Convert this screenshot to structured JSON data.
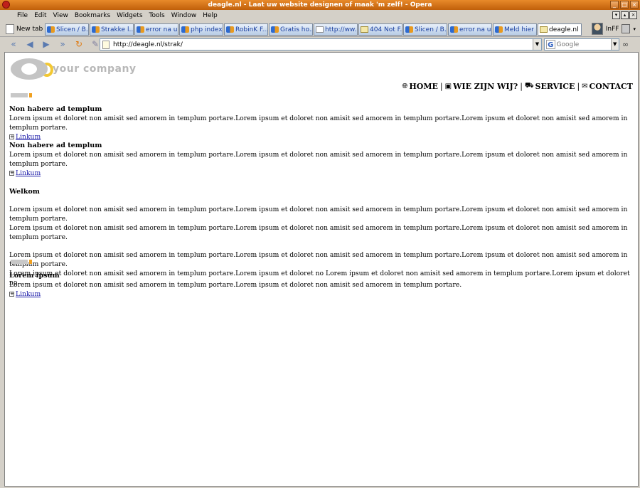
{
  "window": {
    "title": "deagle.nl - Laat uw website designen of maak 'm zelf! - Opera",
    "controls": [
      "_",
      "□",
      "×"
    ]
  },
  "menu": [
    "File",
    "Edit",
    "View",
    "Bookmarks",
    "Widgets",
    "Tools",
    "Window",
    "Help"
  ],
  "mdi_controls": [
    "▾",
    "▴",
    "×"
  ],
  "tabbar": {
    "new_tab_label": "New tab",
    "tabs": [
      {
        "label": "Slicen / B...",
        "icon": "bitmap-icon"
      },
      {
        "label": "Strakke l...",
        "icon": "bitmap-icon"
      },
      {
        "label": "error na u...",
        "icon": "bitmap-icon"
      },
      {
        "label": "php index...",
        "icon": "bitmap-icon"
      },
      {
        "label": "RobinK F...",
        "icon": "bitmap-icon"
      },
      {
        "label": "Gratis ho...",
        "icon": "bitmap-icon"
      },
      {
        "label": "http://ww...",
        "icon": "page-icon"
      },
      {
        "label": "404 Not F...",
        "icon": "doc-icon"
      },
      {
        "label": "Slicen / B...",
        "icon": "bitmap-icon"
      },
      {
        "label": "error na u...",
        "icon": "bitmap-icon"
      },
      {
        "label": "Meld hier ...",
        "icon": "bitmap-icon"
      },
      {
        "label": "deagle.nl ...",
        "icon": "doc-icon",
        "active": true
      }
    ],
    "user_label": "InFF"
  },
  "address": {
    "url": "http://deagle.nl/strak/",
    "search_placeholder": "Google",
    "nav_icons": [
      "rewind-icon",
      "back-icon",
      "forward-icon",
      "fast-forward-icon",
      "reload-icon",
      "edit-icon"
    ]
  },
  "page": {
    "brand": "your company",
    "nav": [
      {
        "label": "HOME",
        "icon": "globe-icon"
      },
      {
        "label": "WIE ZIJN WIJ?",
        "icon": "clipboard-icon"
      },
      {
        "label": "SERVICE",
        "icon": "cart-icon"
      },
      {
        "label": "CONTACT",
        "icon": "envelope-icon"
      }
    ],
    "separator": "|",
    "news": [
      {
        "title": "Non habere ad templum",
        "text": "Lorem ipsum et doloret non amisit sed amorem in templum portare.Lorem ipsum et doloret non amisit sed amorem in templum portare.Lorem ipsum et doloret non amisit sed amorem in templum portare.",
        "link": "Linkum"
      },
      {
        "title": "Non habere ad templum",
        "text": "Lorem ipsum et doloret non amisit sed amorem in templum portare.Lorem ipsum et doloret non amisit sed amorem in templum portare.Lorem ipsum et doloret non amisit sed amorem in templum portare.",
        "link": "Linkum"
      }
    ],
    "welcome": {
      "title": "Welkom",
      "para1_line1": "Lorem ipsum et doloret non amisit sed amorem in templum portare.Lorem ipsum et doloret non amisit sed amorem in templum portare.Lorem ipsum et doloret non amisit sed amorem in templum portare.",
      "para1_line2": "Lorem ipsum et doloret non amisit sed amorem in templum portare.Lorem ipsum et doloret non amisit sed amorem in templum portare.Lorem ipsum et doloret non amisit sed amorem in templum portare.",
      "para2_line1": "Lorem ipsum et doloret non amisit sed amorem in templum portare.Lorem ipsum et doloret non amisit sed amorem in templum portare.Lorem ipsum et doloret non amisit sed amorem in templum portare.",
      "para2_line2": "Lorem ipsum et doloret non amisit sed amorem in templum portare.Lorem ipsum et doloret no Lorem ipsum et doloret non amisit sed amorem in templum portare.Lorem ipsum et doloret no"
    },
    "lorem": {
      "title": "Lorem ipsum",
      "text": "Lorem ipsum et doloret non amisit sed amorem in templum portare.Lorem ipsum et doloret non amisit sed amorem in templum portare.",
      "link": "Linkum"
    }
  },
  "colors": {
    "titlebar": "#d0701a",
    "link": "#1a1aa8",
    "logo_gray": "#c4c4c4",
    "logo_yellow": "#f3c832",
    "marker_orange": "#f0a020"
  }
}
